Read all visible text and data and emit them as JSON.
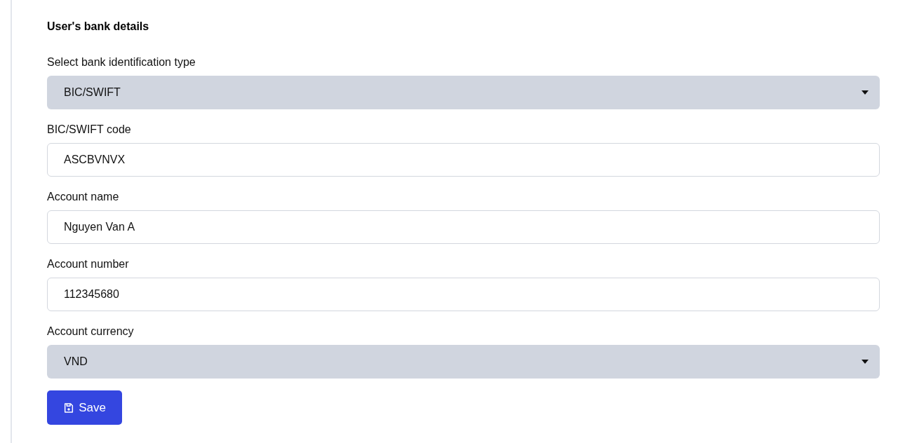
{
  "heading": "User's bank details",
  "fields": [
    {
      "kind": "select",
      "label": "Select bank identification type",
      "value": "BIC/SWIFT"
    },
    {
      "kind": "text",
      "label": "BIC/SWIFT code",
      "value": "ASCBVNVX"
    },
    {
      "kind": "text",
      "label": "Account name",
      "value": "Nguyen Van A"
    },
    {
      "kind": "text",
      "label": "Account number",
      "value": "112345680"
    },
    {
      "kind": "select",
      "label": "Account currency",
      "value": "VND"
    }
  ],
  "save_button": {
    "label": "Save"
  }
}
